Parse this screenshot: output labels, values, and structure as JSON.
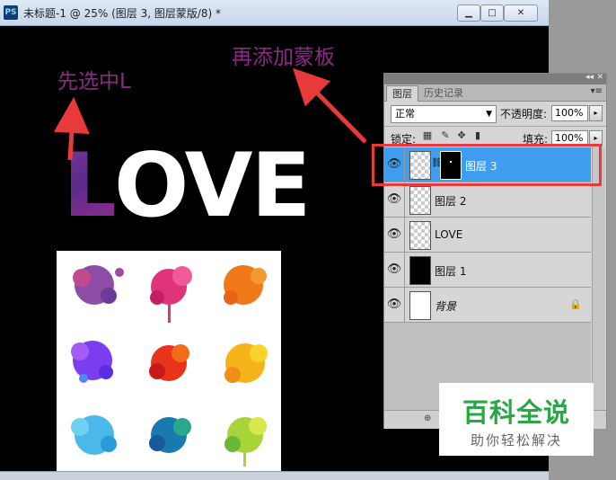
{
  "window": {
    "title": "未标题-1 @ 25% (图层 3, 图层蒙版/8) *",
    "app_icon": "PS",
    "minimize": "▁",
    "maximize": "□",
    "close": "✕"
  },
  "annotations": {
    "select_l": "先选中L",
    "add_mask": "再添加蒙板"
  },
  "canvas": {
    "love_first": "L",
    "love_rest": "OVE"
  },
  "layers_panel": {
    "tabs": [
      "图层",
      "历史记录"
    ],
    "blend_mode": "正常",
    "opacity_label": "不透明度:",
    "opacity": "100%",
    "lock_label": "锁定:",
    "fill_label": "填充:",
    "fill": "100%",
    "footer": "⊕",
    "layers": [
      {
        "name": "图层 3",
        "selected": true,
        "thumb": "checker",
        "has_mask": true
      },
      {
        "name": "图层 2",
        "selected": false,
        "thumb": "checker"
      },
      {
        "name": "LOVE",
        "selected": false,
        "thumb": "checker"
      },
      {
        "name": "图层 1",
        "selected": false,
        "thumb": "black"
      },
      {
        "name": "背景",
        "selected": false,
        "thumb": "white",
        "locked": true
      }
    ]
  },
  "watermark": {
    "main": "百科全说",
    "sub": "助你轻松解决"
  },
  "colors": {
    "annotation": "#8c2a86",
    "highlight": "#e83a3a",
    "selected_layer": "#3f9ef0",
    "watermark_green": "#27a844"
  }
}
